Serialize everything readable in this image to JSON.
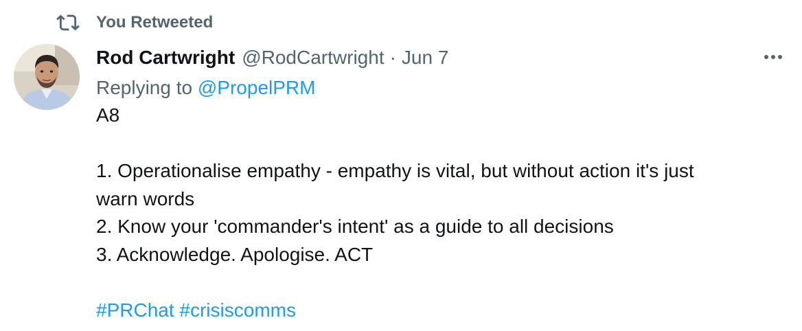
{
  "retweet": {
    "label": "You Retweeted",
    "icon": "retweet-icon"
  },
  "author": {
    "name": "Rod Cartwright",
    "handle": "@RodCartwright",
    "separator": "·",
    "date": "Jun 7",
    "avatar_icon": "avatar"
  },
  "reply": {
    "prefix": "Replying to ",
    "target": "@PropelPRM"
  },
  "body": {
    "lines": [
      "A8",
      "",
      "1. Operationalise empathy - empathy is vital, but without action it's just",
      "warn words",
      "2. Know your 'commander's intent' as a guide to all decisions",
      "3. Acknowledge. Apologise. ACT",
      ""
    ],
    "hashtags": [
      "#PRChat",
      "#crisiscomms"
    ]
  },
  "menu": {
    "icon": "more-icon"
  },
  "colors": {
    "link": "#1d9bf0",
    "muted": "#536471",
    "text": "#0f1419"
  }
}
